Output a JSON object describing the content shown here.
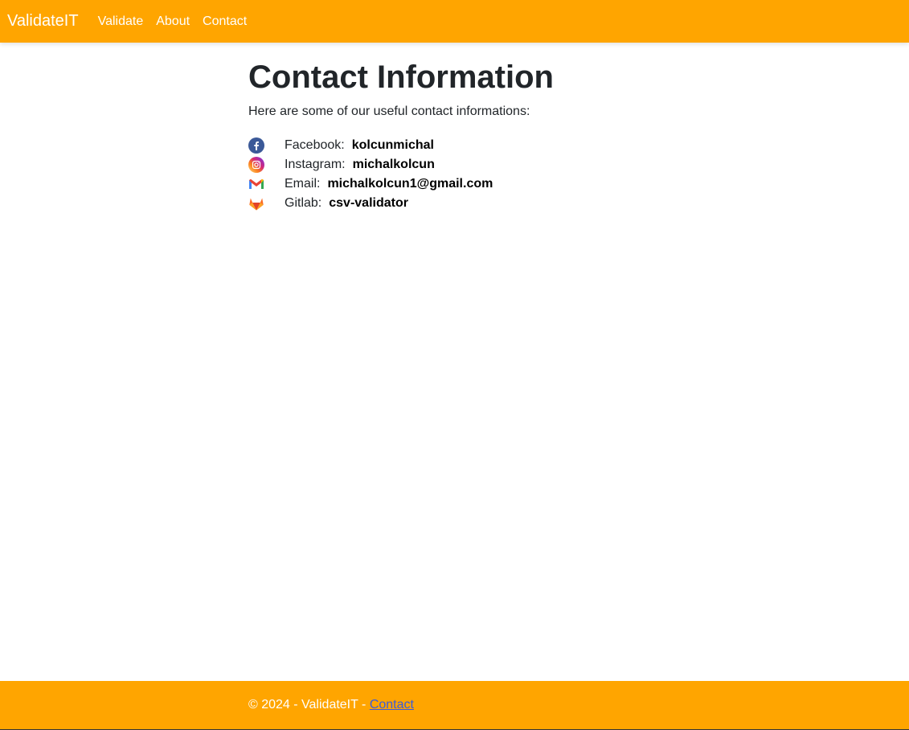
{
  "nav": {
    "brand": "ValidateIT",
    "links": [
      "Validate",
      "About",
      "Contact"
    ]
  },
  "page": {
    "title": "Contact Information",
    "intro": "Here are some of our useful contact informations:"
  },
  "contacts": [
    {
      "icon": "facebook-icon",
      "label": "Facebook:",
      "value": "kolcunmichal"
    },
    {
      "icon": "instagram-icon",
      "label": "Instagram:",
      "value": "michalkolcun"
    },
    {
      "icon": "gmail-icon",
      "label": "Email:",
      "value": "michalkolcun1@gmail.com"
    },
    {
      "icon": "gitlab-icon",
      "label": "Gitlab:",
      "value": "csv-validator"
    }
  ],
  "footer": {
    "text": "© 2024 - ValidateIT - ",
    "link": "Contact"
  },
  "colors": {
    "brand_orange": "#ffa500",
    "text": "#212529",
    "link": "#3b5bdb"
  }
}
